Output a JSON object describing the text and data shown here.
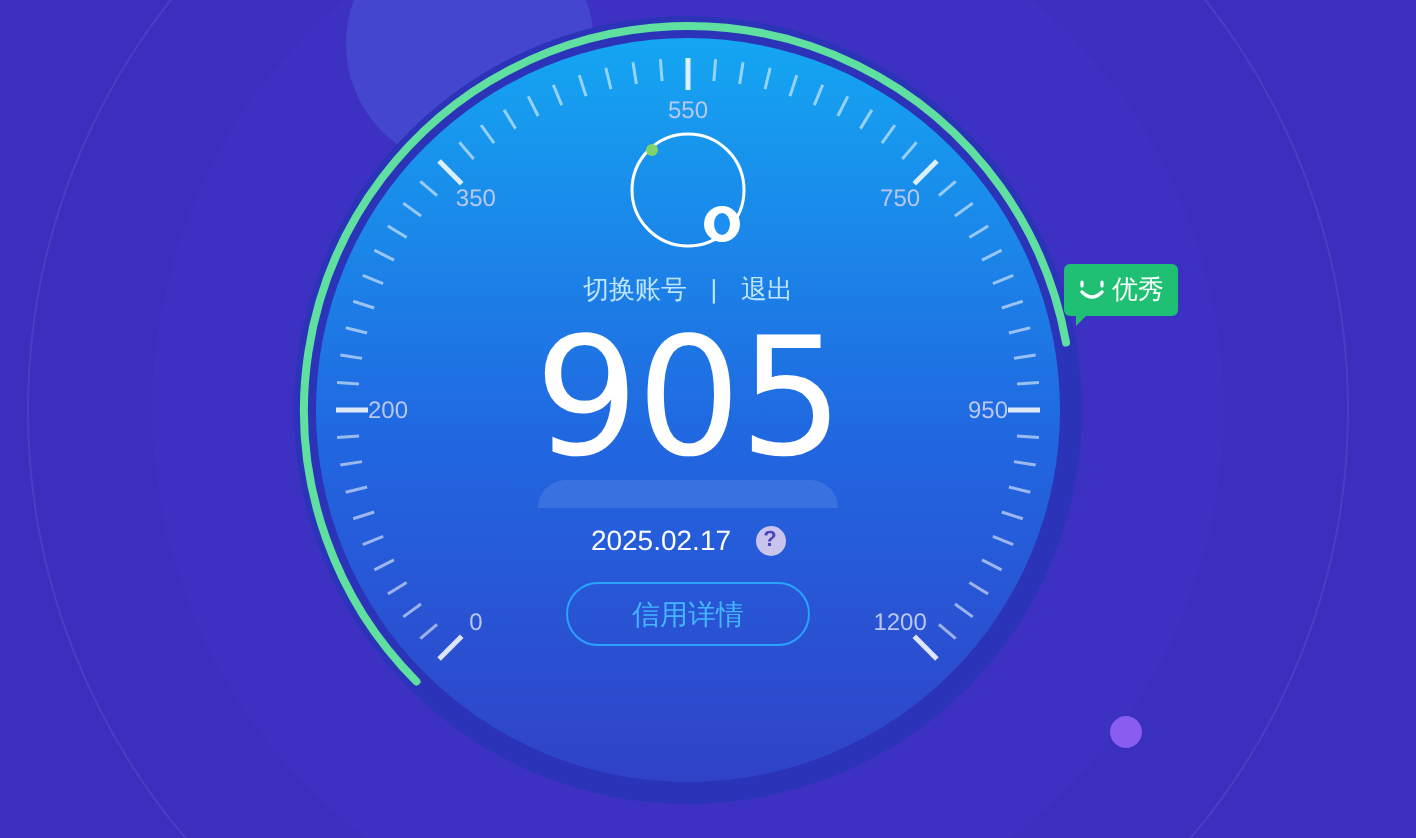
{
  "gauge": {
    "scale_labels": [
      "0",
      "200",
      "350",
      "550",
      "750",
      "950",
      "1200"
    ]
  },
  "account_links": [
    {
      "label": "切换账号"
    },
    {
      "label": "退出"
    }
  ],
  "separator": "|",
  "score": "905",
  "date": "2025.02.17",
  "help_icon_text": "?",
  "details_button": "信用详情",
  "rating_badge": "优秀"
}
